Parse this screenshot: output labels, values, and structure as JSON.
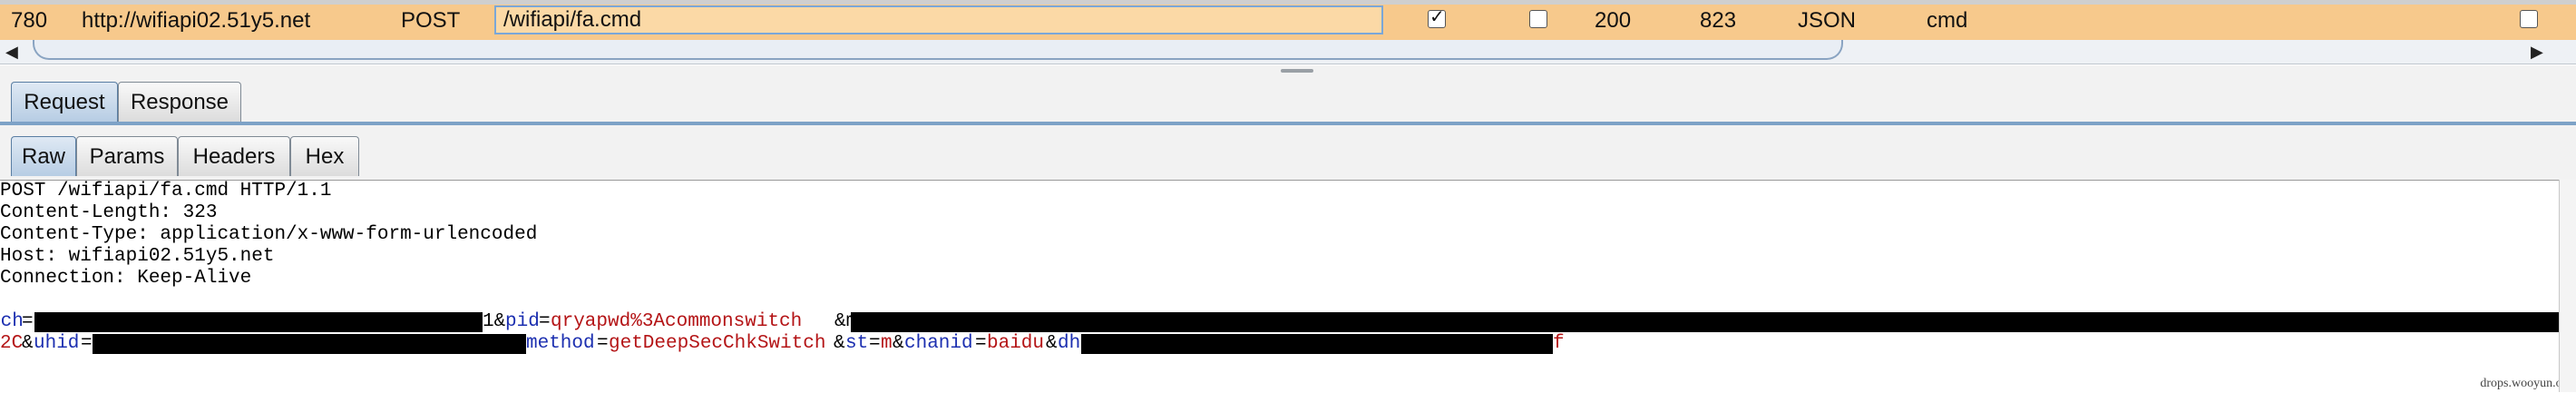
{
  "history_row": {
    "number": "780",
    "host": "http://wifiapi02.51y5.net",
    "method": "POST",
    "url": "/wifiapi/fa.cmd",
    "status": "200",
    "length": "823",
    "mime": "JSON",
    "extension": "cmd",
    "param_checked": true,
    "edited_checked": false,
    "comment_checked": false
  },
  "scrollbar": {
    "left_arrow": "◀",
    "right_arrow": "▶"
  },
  "message_tabs": [
    "Request",
    "Response"
  ],
  "view_tabs": [
    "Raw",
    "Params",
    "Headers",
    "Hex"
  ],
  "request": {
    "line1": "POST /wifiapi/fa.cmd HTTP/1.1",
    "line2": "Content-Length: 323",
    "line3": "Content-Type: application/x-www-form-urlencoded",
    "line4": "Host: wifiapi02.51y5.net",
    "line5": "Connection: Keep-Alive",
    "body1": {
      "p1": "pch",
      "eq1": "=",
      "amp1": "1&",
      "k2": "pid",
      "eq2": "=",
      "v2": "qryapwd%3Acommonswitch",
      "amp2": "&m"
    },
    "body2": {
      "pre": "2C",
      "amp1": "&",
      "k1": "uhid",
      "eq1": "=",
      "k2": "method",
      "eq2": "=",
      "v2": "getDeepSecChkSwitch",
      "amp2": "&",
      "k3": "st",
      "eq3": "=",
      "v3": "m",
      "amp3": "&",
      "k4": "chanid",
      "eq4": "=",
      "v4": "baidu",
      "amp4": "&",
      "k5": "dh",
      "tail": "f"
    }
  },
  "watermark": "drops.wooyun.org"
}
